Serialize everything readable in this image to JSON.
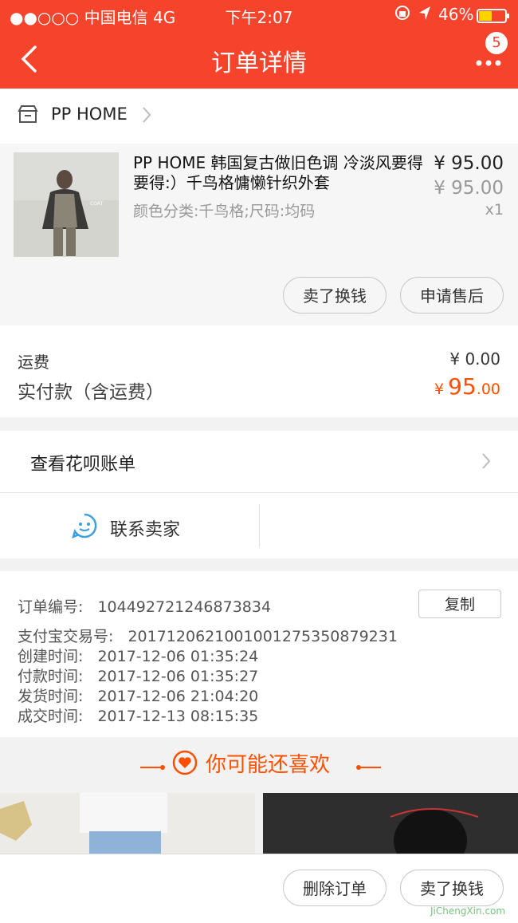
{
  "status_bar": {
    "carrier": "●●○○○ 中国电信   4G",
    "time": "下午2:07",
    "battery": "46%"
  },
  "nav": {
    "title": "订单详情",
    "more_badge": "5"
  },
  "shop": {
    "name": "PP HOME"
  },
  "product": {
    "title": "PP HOME 韩国复古做旧色调 冷淡风要得要得:）千鸟格慵懒针织外套",
    "sku": "颜色分类:千鸟格;尺码:均码",
    "price": "¥ 95.00",
    "original_price": "¥ 95.00",
    "quantity": "x1",
    "image_label": "COAT",
    "buttons": [
      "卖了换钱",
      "申请售后"
    ]
  },
  "fees": {
    "shipping_label": "运费",
    "shipping_value": "¥ 0.00",
    "paid_label": "实付款（含运费）",
    "paid_currency": "¥",
    "paid_int": "95",
    "paid_dec": ".00"
  },
  "huabei": {
    "label": "查看花呗账单"
  },
  "contact": {
    "label": "联系卖家"
  },
  "order_info": {
    "order_no_label": "订单编号:",
    "order_no": "104492721246873834",
    "copy_label": "复制",
    "alipay_label": "支付宝交易号:",
    "alipay_no": "2017120621001001275350879231",
    "created_label": "创建时间:",
    "created": "2017-12-06 01:35:24",
    "paid_label": "付款时间:",
    "paid": "2017-12-06 01:35:27",
    "shipped_label": "发货时间:",
    "shipped": "2017-12-06 21:04:20",
    "done_label": "成交时间:",
    "done": "2017-12-13 08:15:35"
  },
  "recommend": {
    "title": "你可能还喜欢"
  },
  "bottom": {
    "buttons": [
      "删除订单",
      "卖了换钱"
    ],
    "watermark": "JiChengXin.com"
  },
  "colors": {
    "brand": "#f5432c",
    "price_accent": "#ff5000"
  }
}
